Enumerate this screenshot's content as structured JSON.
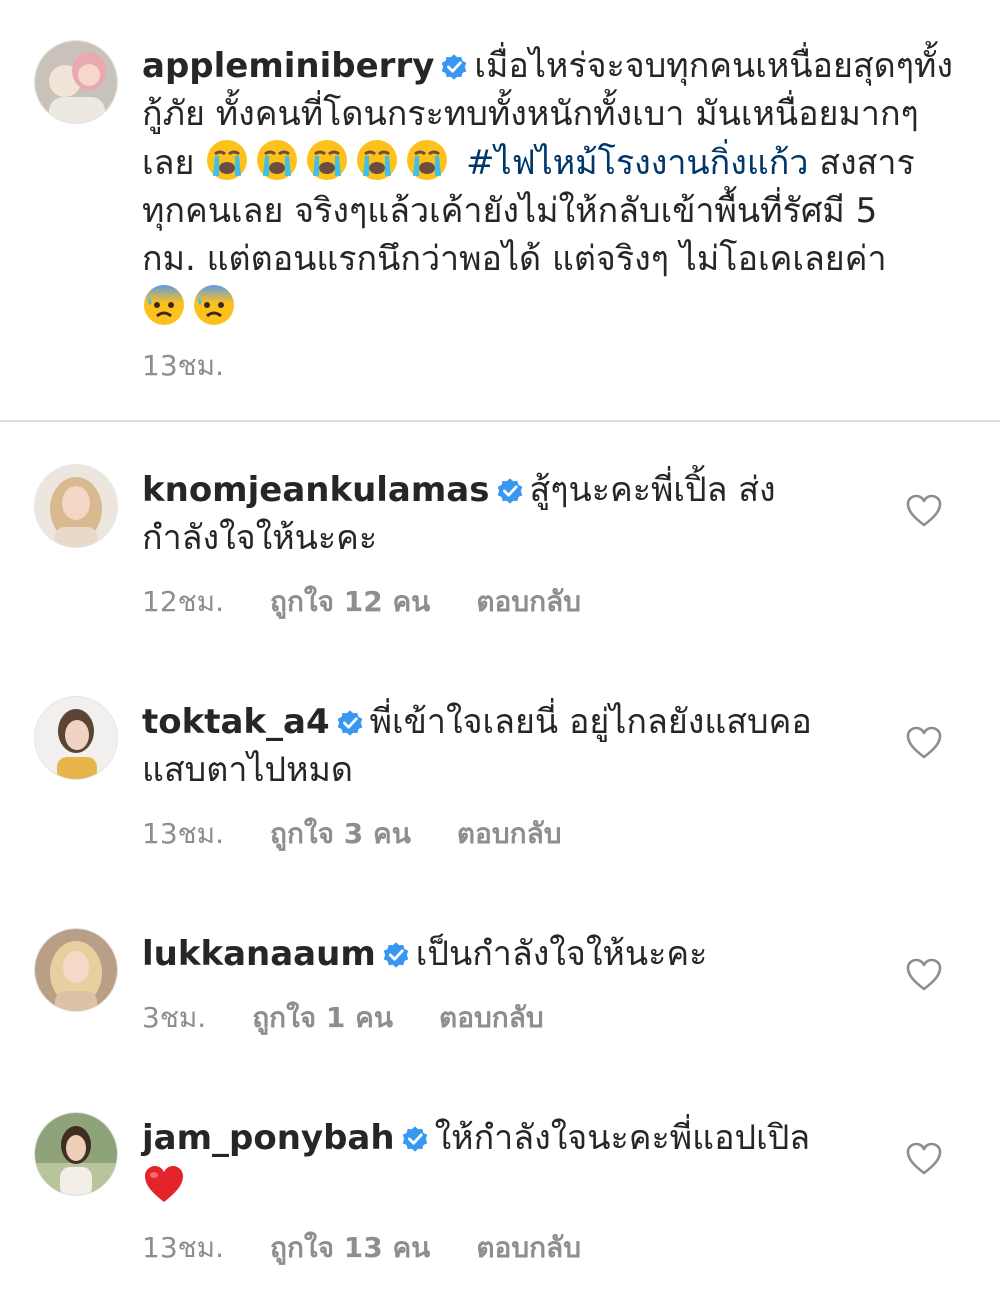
{
  "post": {
    "username": "appleminiberry",
    "caption_line1": "เมื่อไหร่จะจบทุกคนเหนื่อยสุดๆทั้ง",
    "caption_line2": "กู้ภัย ทั้งคนที่โดนกระทบทั้งหนักทั้งเบา มันเหนื่อยมากๆ",
    "caption_line3_pre": "เลย",
    "hashtag": "#ไฟไหม้โรงงานกิ่งแก้ว",
    "caption_line3_post": "สงสาร",
    "caption_line4": "ทุกคนเลย จริงๆแล้วเค้ายังไม่ให้กลับเข้าพื้นที่รัศมี 5",
    "caption_line5": "กม. แต่ตอนแรกนึกว่าพอได้ แต่จริงๆ ไม่โอเคเลยค่า",
    "time": "13ชม.",
    "emoji_crying_count": 5,
    "emoji_anxious_count": 2
  },
  "comments": [
    {
      "username": "knomjeankulamas",
      "text_line1": "สู้ๆนะคะพี่เปิ้ล ส่ง",
      "text_line2": "กำลังใจให้นะคะ",
      "time": "12ชม.",
      "likes": "ถูกใจ 12 คน",
      "reply": "ตอบกลับ"
    },
    {
      "username": "toktak_a4",
      "text_line1": "พี่เข้าใจเลยนี่ อยู่ไกลยังแสบคอ",
      "text_line2": "แสบตาไปหมด",
      "time": "13ชม.",
      "likes": "ถูกใจ 3 คน",
      "reply": "ตอบกลับ"
    },
    {
      "username": "lukkanaaum",
      "text_line1": "เป็นกำลังใจให้นะคะ",
      "time": "3ชม.",
      "likes": "ถูกใจ 1 คน",
      "reply": "ตอบกลับ"
    },
    {
      "username": "jam_ponybah",
      "text_line1": "ให้กำลังใจนะคะพี่แอปเปิล",
      "time": "13ชม.",
      "likes": "ถูกใจ 13 คน",
      "reply": "ตอบกลับ"
    }
  ],
  "colors": {
    "verified_blue": "#3897f0",
    "hashtag_blue": "#00376b",
    "meta_gray": "#8e8e8e",
    "heart_red": "#ed4956"
  }
}
